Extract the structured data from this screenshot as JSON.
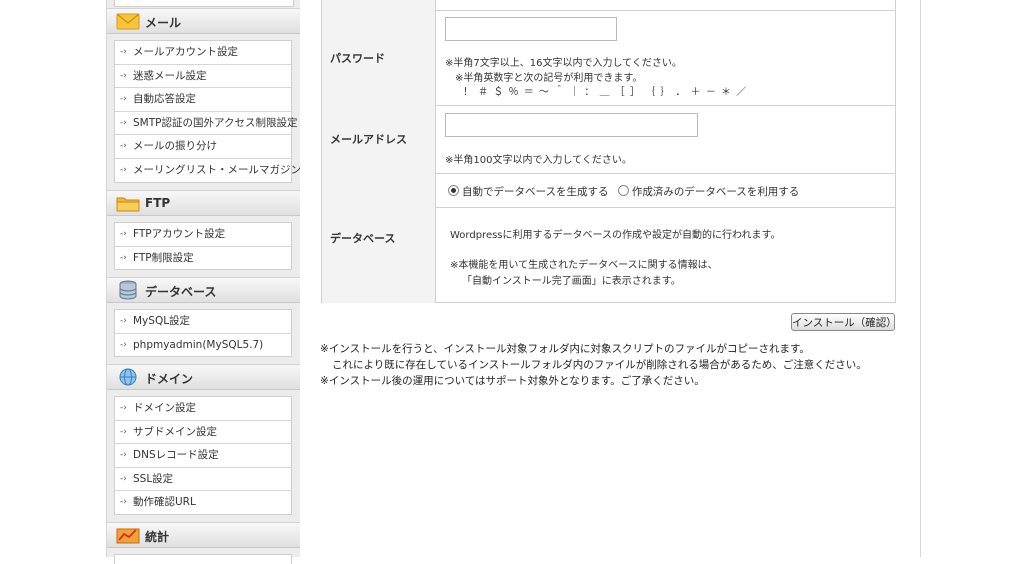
{
  "sidebar": {
    "sections": [
      {
        "id": "mail",
        "title": "メール",
        "icon": "mail-icon",
        "items": [
          "メールアカウント設定",
          "迷惑メール設定",
          "自動応答設定",
          "SMTP認証の国外アクセス制限設定",
          "メールの振り分け",
          "メーリングリスト・メールマガジン"
        ]
      },
      {
        "id": "ftp",
        "title": "FTP",
        "icon": "folder-icon",
        "items": [
          "FTPアカウント設定",
          "FTP制限設定"
        ]
      },
      {
        "id": "database",
        "title": "データベース",
        "icon": "database-icon",
        "items": [
          "MySQL設定",
          "phpmyadmin(MySQL5.7)"
        ]
      },
      {
        "id": "domain",
        "title": "ドメイン",
        "icon": "globe-icon",
        "items": [
          "ドメイン設定",
          "サブドメイン設定",
          "DNSレコード設定",
          "SSL設定",
          "動作確認URL"
        ]
      },
      {
        "id": "stats",
        "title": "統計",
        "icon": "stats-icon",
        "items": []
      }
    ]
  },
  "form": {
    "password": {
      "label": "パスワード",
      "value": "",
      "note1": "※半角7文字以上、16文字以内で入力してください。",
      "note2": "※半角英数字と次の記号が利用できます。",
      "symbols": "！ ＃ ＄ ％ ＝ ～ ＾ ｜ ： ＿ ［ ］ ｛ ｝ ． ＋ － ＊ ／"
    },
    "email": {
      "label": "メールアドレス",
      "value": "",
      "note": "※半角100文字以内で入力してください。"
    },
    "database": {
      "label": "データベース",
      "option_auto": "自動でデータベースを生成する",
      "option_existing": "作成済みのデータベースを利用する",
      "selected": "auto",
      "desc": "Wordpressに利用するデータベースの作成や設定が自動的に行われます。",
      "note1": "※本機能を用いて生成されたデータベースに関する情報は、",
      "note2": "「自動インストール完了画面」に表示されます。"
    }
  },
  "install_button": "インストール（確認）",
  "messages": {
    "line1": "※インストールを行うと、インストール対象フォルダ内に対象スクリプトのファイルがコピーされます。",
    "line2": "これにより既に存在しているインストールフォルダ内のファイルが削除される場合があるため、ご注意ください。",
    "line3": "※インストール後の運用についてはサポート対象外となります。ご了承ください。"
  },
  "colors": {
    "sidebar_bg": "#ececec",
    "label_bg": "#f3f3f3",
    "border": "#d0d0d0"
  }
}
